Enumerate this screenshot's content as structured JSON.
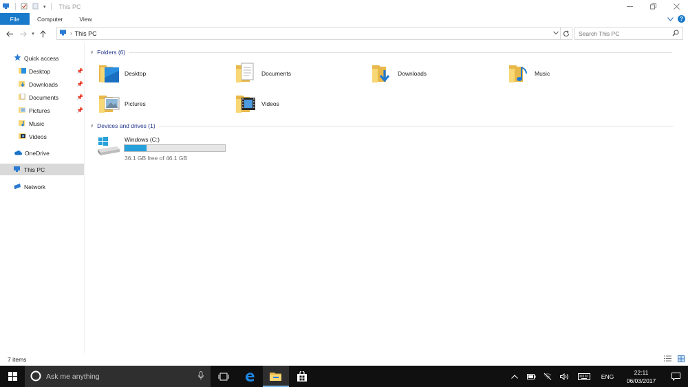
{
  "window": {
    "title": "This PC"
  },
  "ribbon": {
    "tabs": [
      "File",
      "Computer",
      "View"
    ]
  },
  "address": {
    "location": "This PC",
    "search_placeholder": "Search This PC"
  },
  "nav_pane": {
    "quick_access": "Quick access",
    "pinned": [
      {
        "label": "Desktop",
        "pinned": true
      },
      {
        "label": "Downloads",
        "pinned": true
      },
      {
        "label": "Documents",
        "pinned": true
      },
      {
        "label": "Pictures",
        "pinned": true
      },
      {
        "label": "Music",
        "pinned": false
      },
      {
        "label": "Videos",
        "pinned": false
      }
    ],
    "onedrive": "OneDrive",
    "this_pc": "This PC",
    "network": "Network"
  },
  "content": {
    "folders_header": "Folders (6)",
    "folders": [
      "Desktop",
      "Documents",
      "Downloads",
      "Music",
      "Pictures",
      "Videos"
    ],
    "devices_header": "Devices and drives (1)",
    "drive": {
      "name": "Windows (C:)",
      "free_text": "36.1 GB free of 46.1 GB",
      "used_fraction": 0.217
    }
  },
  "status": {
    "items": "7 items"
  },
  "taskbar": {
    "search_placeholder": "Ask me anything",
    "language": "ENG",
    "time": "22:11",
    "date": "06/03/2017"
  },
  "colors": {
    "accent": "#1979ca",
    "folder": "#f8d775",
    "drive_bar": "#26a0da",
    "taskbar": "#101010"
  }
}
